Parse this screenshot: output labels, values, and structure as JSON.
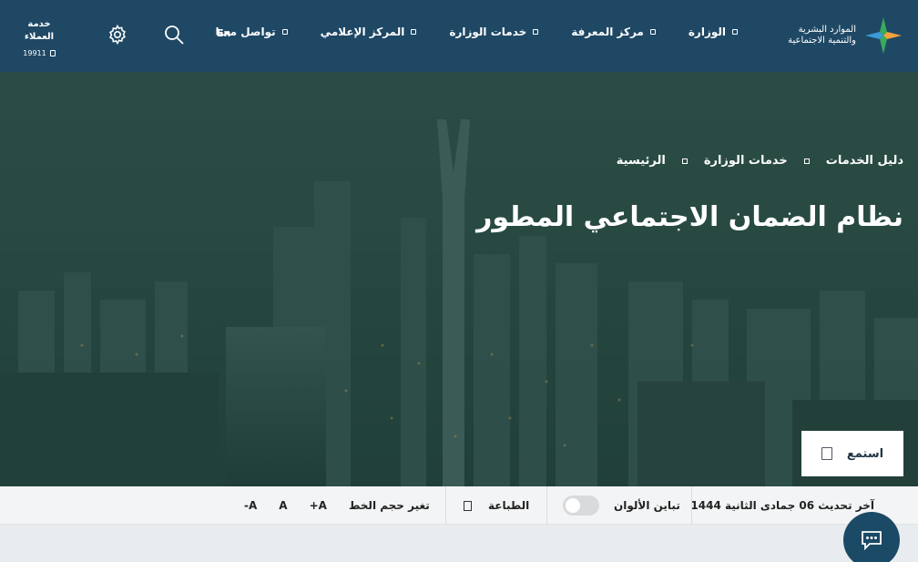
{
  "header": {
    "customer_service": {
      "label": "خدمة العملاء",
      "phone": "19911"
    },
    "lang_toggle": "En",
    "nav": [
      {
        "label": "الوزارة"
      },
      {
        "label": "مركز المعرفة"
      },
      {
        "label": "خدمات الوزارة"
      },
      {
        "label": "المركز الإعلامي"
      },
      {
        "label": "تواصل معنا"
      }
    ],
    "logo_text": [
      "الموارد البشرية",
      "والتنمية الاجتماعية"
    ]
  },
  "hero": {
    "breadcrumb": [
      "الرئيسية",
      "خدمات الوزارة",
      "دليل الخدمات"
    ],
    "title": "نظام الضمان الاجتماعي المطور",
    "listen_label": "استمع"
  },
  "toolbar": {
    "last_update": "آخر تحديث 06 جمادى الثانية 1444",
    "contrast_label": "تباين الألوان",
    "print_label": "الطباعة",
    "font_size_label": "تغير حجم الخط",
    "font_increase": "A+",
    "font_reset": "A",
    "font_decrease": "A-"
  },
  "colors": {
    "header_bg": "#1f4865",
    "chat_bg": "#1b4a66",
    "logo_green": "#3aaa5c",
    "logo_orange": "#f2a33a",
    "logo_blue": "#3b9ad6"
  }
}
